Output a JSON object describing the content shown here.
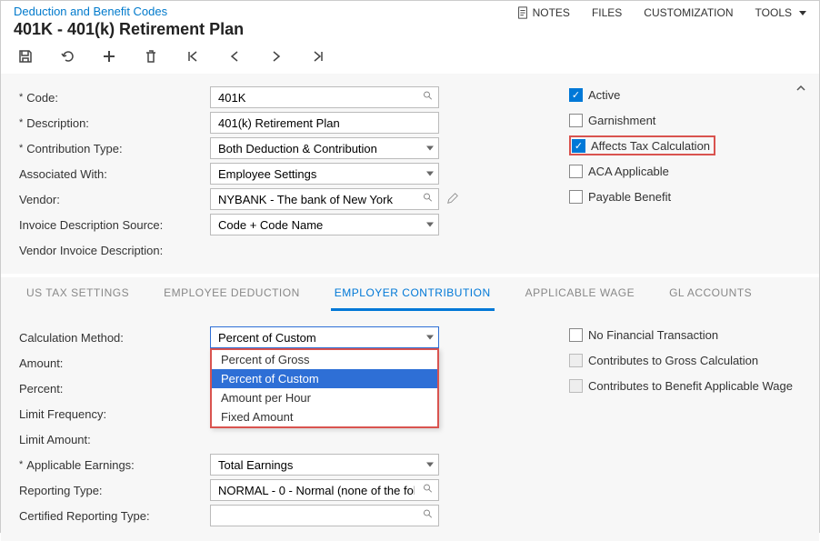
{
  "breadcrumb": "Deduction and Benefit Codes",
  "page_title": "401K - 401(k) Retirement Plan",
  "top_links": {
    "notes": "NOTES",
    "files": "FILES",
    "customization": "CUSTOMIZATION",
    "tools": "TOOLS"
  },
  "fields": {
    "code": {
      "label": "Code:",
      "value": "401K"
    },
    "description": {
      "label": "Description:",
      "value": "401(k) Retirement Plan"
    },
    "contribution_type": {
      "label": "Contribution Type:",
      "value": "Both Deduction & Contribution"
    },
    "associated_with": {
      "label": "Associated With:",
      "value": "Employee Settings"
    },
    "vendor": {
      "label": "Vendor:",
      "value": "NYBANK - The bank of New York"
    },
    "invoice_desc_source": {
      "label": "Invoice Description Source:",
      "value": "Code + Code Name"
    },
    "vendor_invoice_desc": {
      "label": "Vendor Invoice Description:",
      "value": ""
    }
  },
  "checks": {
    "active": "Active",
    "garnishment": "Garnishment",
    "affects_tax": "Affects Tax Calculation",
    "aca": "ACA Applicable",
    "payable": "Payable Benefit"
  },
  "tabs": {
    "us_tax": "US TAX SETTINGS",
    "emp_deduction": "EMPLOYEE DEDUCTION",
    "emp_contribution": "EMPLOYER CONTRIBUTION",
    "applicable_wage": "APPLICABLE WAGE",
    "gl_accounts": "GL ACCOUNTS"
  },
  "tab_content": {
    "calc_method": {
      "label": "Calculation Method:",
      "value": "Percent of Custom"
    },
    "amount": {
      "label": "Amount:"
    },
    "percent": {
      "label": "Percent:"
    },
    "limit_freq": {
      "label": "Limit Frequency:"
    },
    "limit_amount": {
      "label": "Limit Amount:"
    },
    "applicable_earnings": {
      "label": "Applicable Earnings:",
      "value": "Total Earnings"
    },
    "reporting_type": {
      "label": "Reporting Type:",
      "value": "NORMAL - 0 - Normal (none of the foll"
    },
    "certified_reporting": {
      "label": "Certified Reporting Type:",
      "value": ""
    }
  },
  "dropdown_options": [
    "Percent of Gross",
    "Percent of Custom",
    "Amount per Hour",
    "Fixed Amount"
  ],
  "right_checks": {
    "no_fin": "No Financial Transaction",
    "contrib_gross": "Contributes to Gross Calculation",
    "contrib_benefit": "Contributes to Benefit Applicable Wage"
  }
}
